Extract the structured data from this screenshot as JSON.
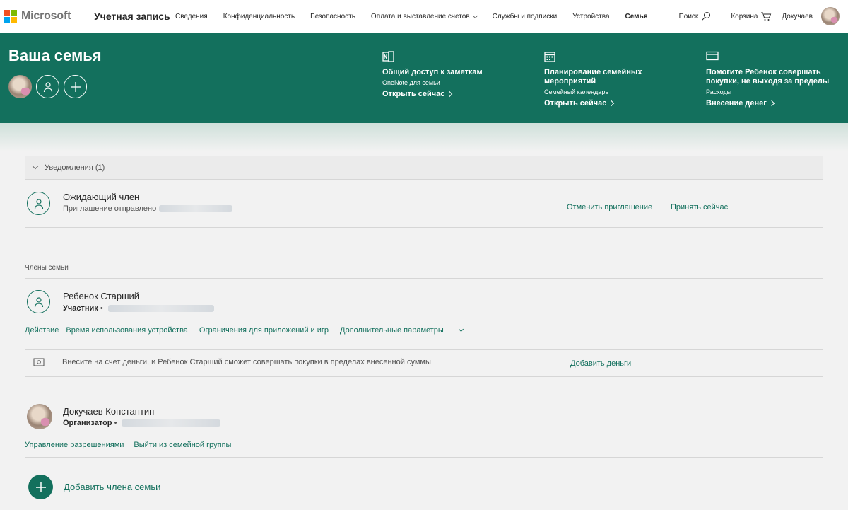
{
  "header": {
    "logo_text": "Microsoft",
    "brand": "Учетная запись",
    "nav": [
      {
        "label": "Сведения"
      },
      {
        "label": "Конфиденциальность"
      },
      {
        "label": "Безопасность"
      },
      {
        "label": "Оплата и выставление счетов"
      },
      {
        "label": "Службы и подписки"
      },
      {
        "label": "Устройства"
      },
      {
        "label": "Семья"
      }
    ],
    "search": "Поиск",
    "cart": "Корзина",
    "user": "Докучаев"
  },
  "banner": {
    "title": "Ваша семья",
    "features": [
      {
        "title": "Общий доступ к заметкам",
        "subtitle": "OneNote для семьи",
        "link": "Открыть сейчас",
        "icon": "onenote-icon"
      },
      {
        "title": "Планирование семейных мероприятий",
        "subtitle": "Семейный календарь",
        "link": "Открыть сейчас",
        "icon": "calendar-icon"
      },
      {
        "title": "Помогите Ребенок совершать покупки, не выходя за пределы",
        "subtitle": "Расходы",
        "link": "Внесение денег",
        "icon": "card-icon"
      }
    ]
  },
  "notifications": {
    "header": "Уведомления (1)",
    "pending": {
      "name": "Ожидающий член",
      "sub": "Приглашение отправлено",
      "cancel": "Отменить приглашение",
      "accept": "Принять сейчас"
    }
  },
  "members": {
    "label": "Члены семьи",
    "child": {
      "name": "Ребенок Старший",
      "role": "Участник",
      "actions": [
        "Действие",
        "Время использования устройства",
        "Ограничения для приложений и игр",
        "Дополнительные параметры"
      ],
      "money_text": "Внесите на счет деньги, и Ребенок Старший сможет совершать покупки в пределах внесенной суммы",
      "money_link": "Добавить деньги"
    },
    "organizer": {
      "name": "Докучаев Константин",
      "role": "Организатор",
      "actions": [
        "Управление разрешениями",
        "Выйти из семейной группы"
      ]
    },
    "add_member": "Добавить члена семьи"
  },
  "colors": {
    "accent": "#13705d",
    "ms_red": "#f25022",
    "ms_green": "#7fba00",
    "ms_blue": "#00a4ef",
    "ms_yellow": "#ffb900"
  }
}
